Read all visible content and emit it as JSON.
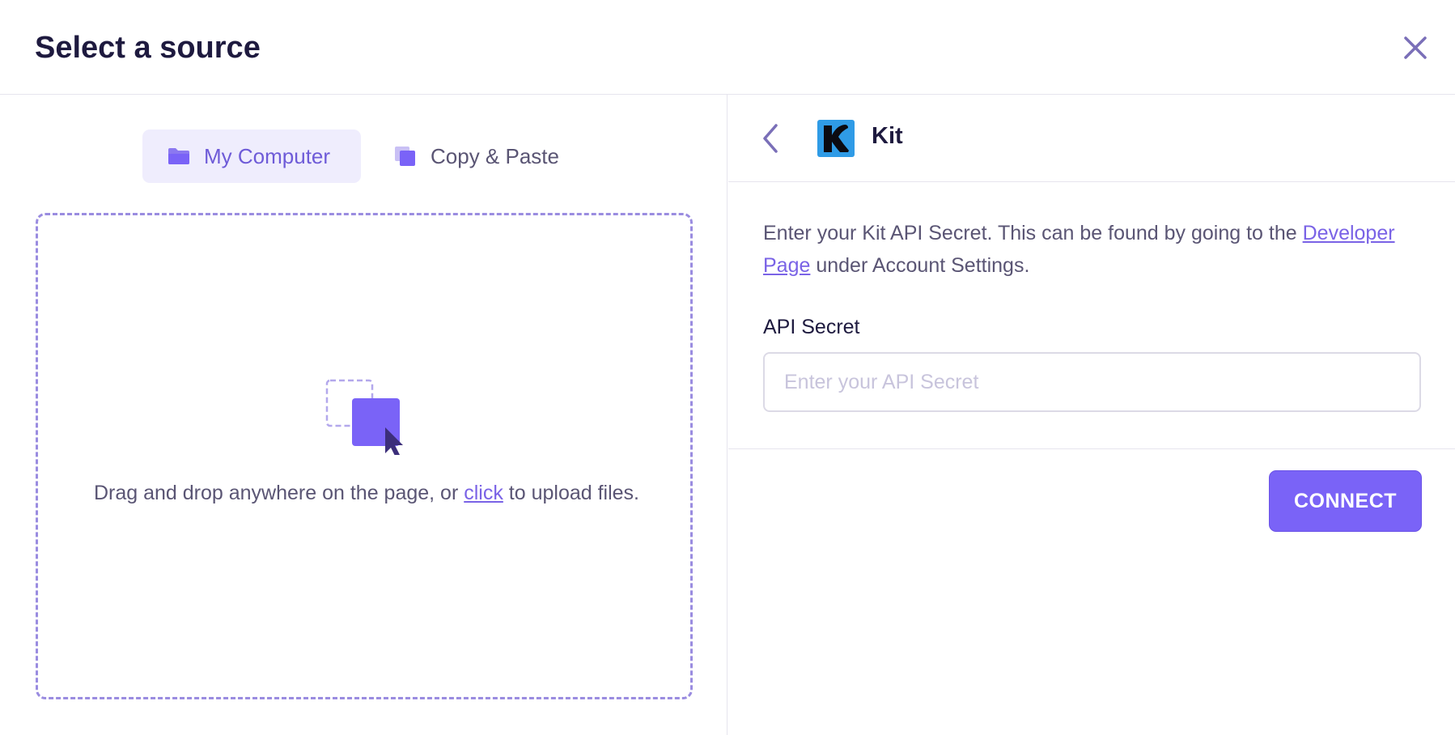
{
  "modal": {
    "title": "Select a source"
  },
  "tabs": [
    {
      "label": "My Computer",
      "icon": "folder-icon",
      "active": true
    },
    {
      "label": "Copy & Paste",
      "icon": "copy-icon",
      "active": false
    }
  ],
  "dropzone": {
    "text_before": "Drag and drop anywhere on the page, or ",
    "link_text": "click",
    "text_after": " to upload files."
  },
  "integration": {
    "name": "Kit",
    "description_before": "Enter your Kit API Secret. This can be found by going to the ",
    "description_link": "Developer Page",
    "description_after": " under Account Settings.",
    "field_label": "API Secret",
    "field_placeholder": "Enter your API Secret",
    "field_value": "",
    "connect_label": "CONNECT"
  },
  "colors": {
    "accent": "#7a63f7",
    "accent_light": "#efedfd",
    "text_dark": "#1e1a3f",
    "text_muted": "#5a5574",
    "kit_logo_bg": "#2f9be6"
  }
}
